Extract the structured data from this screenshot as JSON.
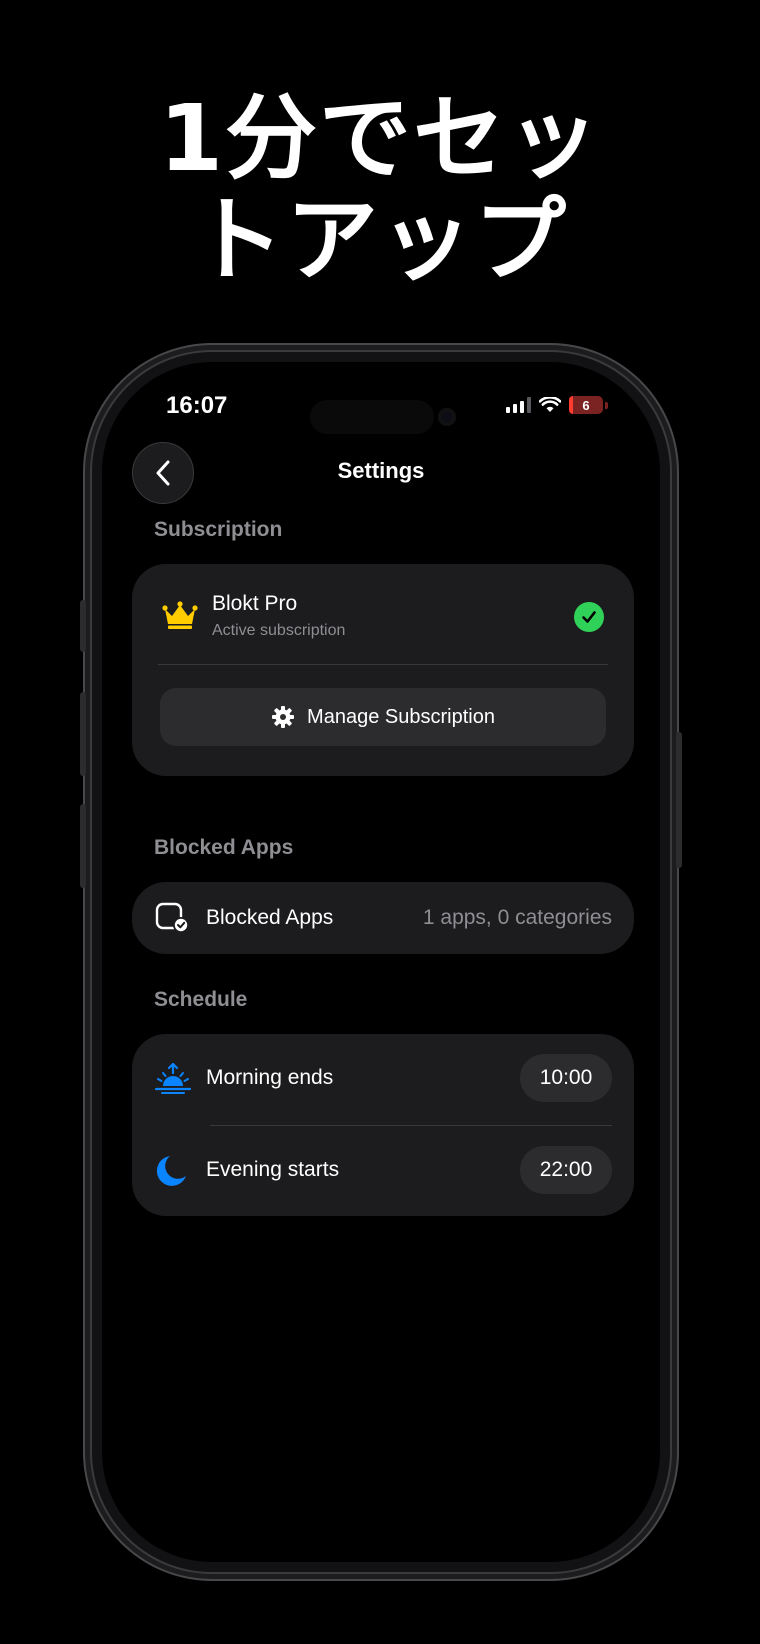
{
  "headline": {
    "line1": "1分でセッ",
    "line2": "トアップ"
  },
  "status_bar": {
    "time": "16:07",
    "battery": "6"
  },
  "nav": {
    "title": "Settings"
  },
  "subscription": {
    "section_label": "Subscription",
    "plan_name": "Blokt Pro",
    "status": "Active subscription",
    "manage_label": "Manage Subscription"
  },
  "blocked_apps": {
    "section_label": "Blocked Apps",
    "row_label": "Blocked Apps",
    "row_value": "1 apps, 0 categories"
  },
  "schedule": {
    "section_label": "Schedule",
    "items": [
      {
        "label": "Morning ends",
        "time": "10:00",
        "icon": "sunrise-icon"
      },
      {
        "label": "Evening starts",
        "time": "22:00",
        "icon": "moon-icon"
      }
    ]
  },
  "colors": {
    "accent_blue": "#0a84ff",
    "crown_yellow": "#ffcc00",
    "success_green": "#30d158",
    "card_bg": "#1c1c1e"
  }
}
